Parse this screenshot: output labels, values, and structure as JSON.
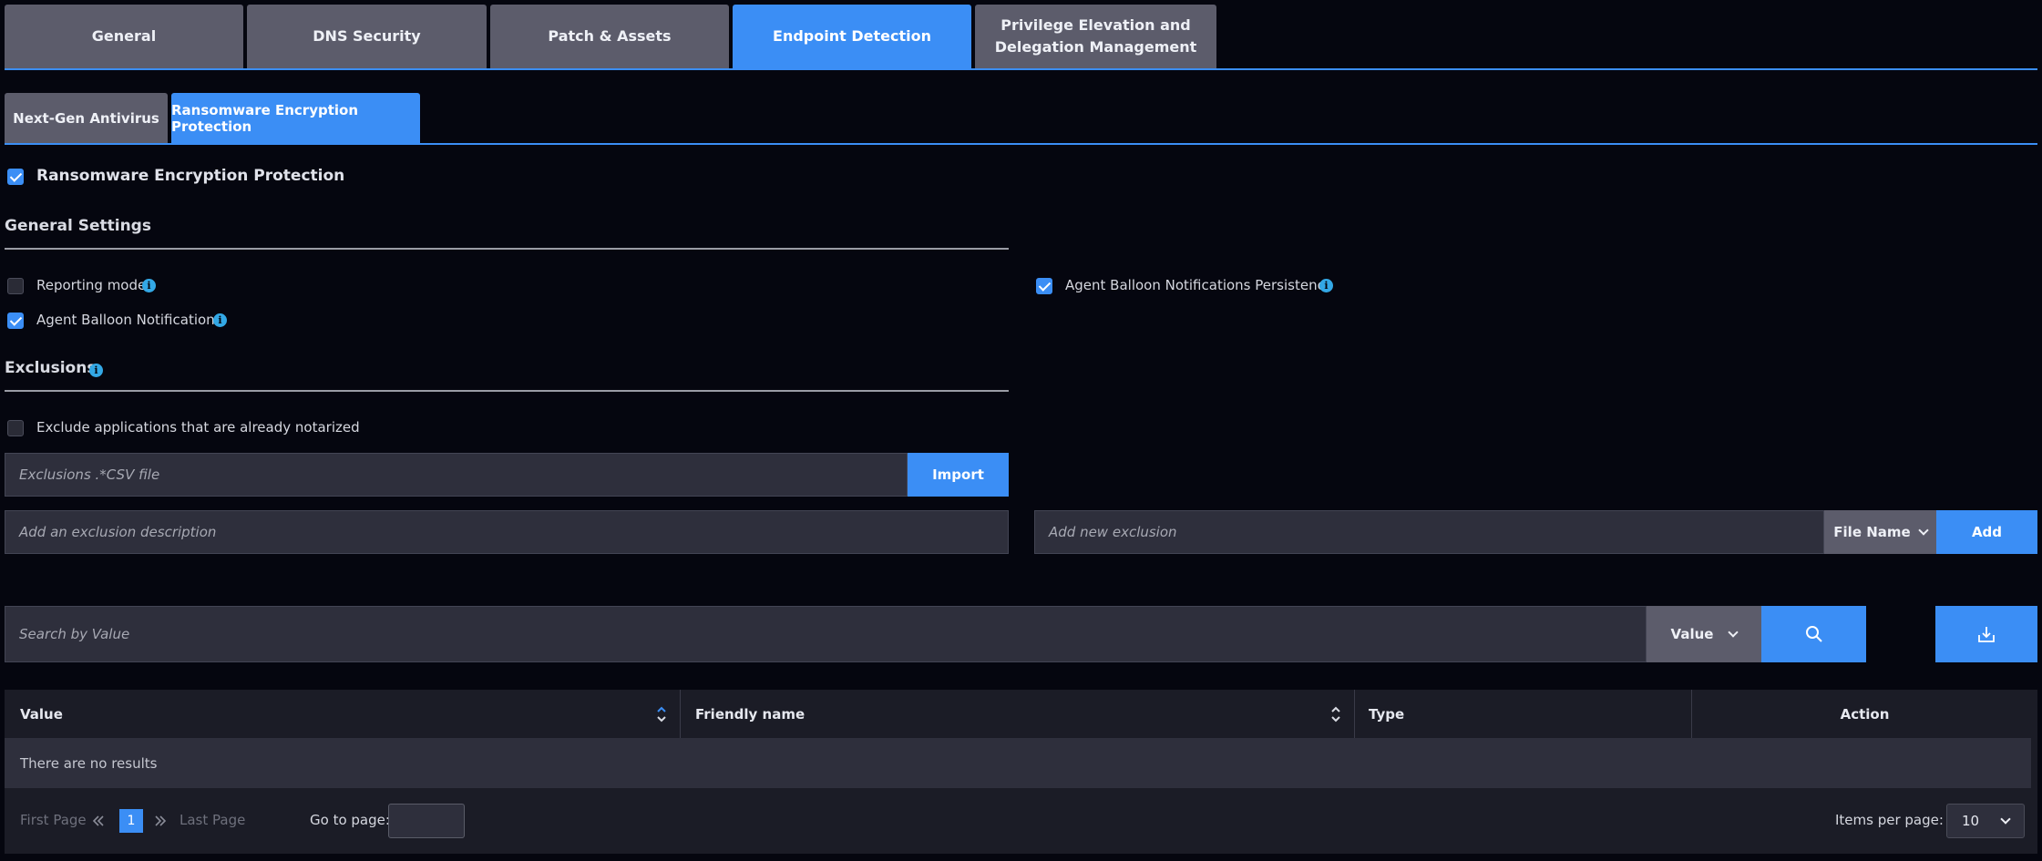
{
  "tabs": [
    "General",
    "DNS Security",
    "Patch & Assets",
    "Endpoint Detection",
    "Privilege Elevation and",
    "Delegation Management"
  ],
  "sub_tabs": [
    "Next-Gen Antivirus",
    "Ransomware Encryption Protection"
  ],
  "main_toggle": {
    "label": "Ransomware Encryption Protection",
    "checked": true
  },
  "general_settings": {
    "title": "General Settings",
    "reporting_mode": {
      "label": "Reporting mode",
      "checked": false
    },
    "agent_balloon": {
      "label": "Agent Balloon Notifications",
      "checked": true
    },
    "agent_balloon_persistence": {
      "label": "Agent Balloon Notifications Persistence",
      "checked": true
    }
  },
  "exclusions": {
    "title": "Exclusions",
    "exclude_notarized": {
      "label": "Exclude applications that are already notarized",
      "checked": false
    },
    "csv_placeholder": "Exclusions .*CSV file",
    "import_label": "Import",
    "description_placeholder": "Add an exclusion description",
    "new_exclusion_placeholder": "Add new exclusion",
    "type_select": "File Name",
    "add_label": "Add"
  },
  "search": {
    "placeholder": "Search by Value",
    "field_select": "Value"
  },
  "table": {
    "columns": [
      "Value",
      "Friendly name",
      "Type",
      "Action"
    ],
    "empty_text": "There are no results"
  },
  "pagination": {
    "first": "First Page",
    "current": "1",
    "last": "Last Page",
    "goto_label": "Go to page:",
    "items_label": "Items per page:",
    "items_value": "10"
  },
  "colors": {
    "accent": "#3b8ef5",
    "tab_gray": "#5c5c6b",
    "background": "#05060f",
    "info": "#33a8e6"
  }
}
